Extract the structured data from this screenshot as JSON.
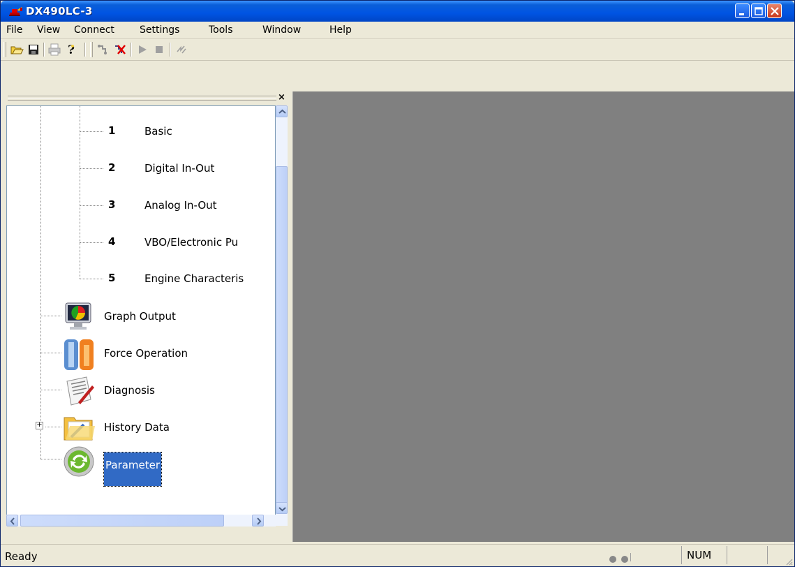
{
  "window": {
    "title": "DX490LC-3"
  },
  "menu": [
    "File",
    "View",
    "Connect",
    "Settings",
    "Tools",
    "Window",
    "Help"
  ],
  "toolbar": {
    "icons": [
      "open-folder-icon",
      "save-icon",
      "print-icon",
      "help-icon",
      "connect-icon",
      "disconnect-icon",
      "play-icon",
      "stop-icon",
      "refresh-icon"
    ]
  },
  "panel": {
    "close_label": "×"
  },
  "tree": {
    "sub_items": [
      {
        "num": "1",
        "label": "Basic"
      },
      {
        "num": "2",
        "label": "Digital In-Out"
      },
      {
        "num": "3",
        "label": "Analog In-Out"
      },
      {
        "num": "4",
        "label": "VBO/Electronic Pu"
      },
      {
        "num": "5",
        "label": "Engine Characteris"
      }
    ],
    "items": [
      {
        "label": "Graph Output",
        "icon": "graph-output-icon"
      },
      {
        "label": "Force Operation",
        "icon": "force-operation-icon"
      },
      {
        "label": "Diagnosis",
        "icon": "diagnosis-icon"
      },
      {
        "label": "History Data",
        "icon": "history-data-icon"
      },
      {
        "label": "Parameter",
        "icon": "parameter-icon"
      }
    ],
    "expander": "+"
  },
  "status": {
    "text": "Ready",
    "num": "NUM"
  },
  "colors": {
    "titlebar": "#0054e3",
    "selection": "#316ac5",
    "mdi_background": "#808080"
  }
}
